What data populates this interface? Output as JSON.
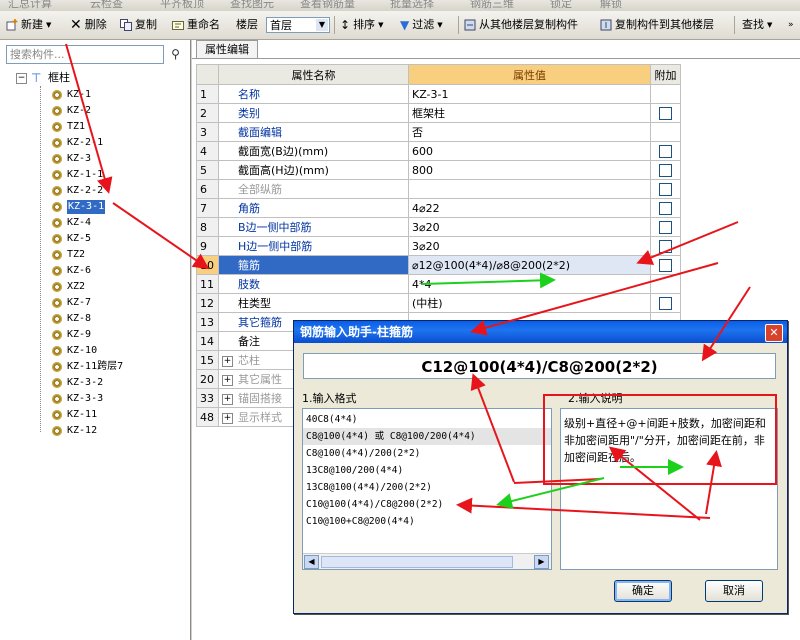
{
  "top_strip": [
    "汇总计算",
    "云检查",
    "平齐板顶",
    "查找图元",
    "查看钢筋量",
    "批量选择",
    "钢筋三维",
    "锁定",
    "解锁"
  ],
  "toolbar": {
    "new_label": "新建",
    "delete_label": "删除",
    "copy_label": "复制",
    "rename_label": "重命名",
    "floor_label": "楼层",
    "floor_value": "首层",
    "sort_label": "排序",
    "filter_label": "过滤",
    "copy_from_floor_label": "从其他楼层复制构件",
    "copy_to_floor_label": "复制构件到其他楼层",
    "find_label": "查找"
  },
  "sidebar": {
    "search_placeholder": "搜索构件...",
    "root_label": "框柱",
    "items": [
      "KZ-1",
      "KZ-2",
      "TZ1",
      "KZ-2-1",
      "KZ-3",
      "KZ-1-1",
      "KZ-2-2",
      "KZ-3-1",
      "KZ-4",
      "KZ-5",
      "TZ2",
      "KZ-6",
      "XZ2",
      "KZ-7",
      "KZ-8",
      "KZ-9",
      "KZ-10",
      "KZ-11跨层7",
      "KZ-3-2",
      "KZ-3-3",
      "KZ-11",
      "KZ-12"
    ],
    "selected_index": 7
  },
  "props": {
    "tab_label": "属性编辑",
    "header": {
      "name": "属性名称",
      "value": "属性值",
      "extra": "附加"
    },
    "rows": [
      {
        "num": "1",
        "name": "名称",
        "value": "KZ-3-1",
        "style": "blue",
        "check": false
      },
      {
        "num": "2",
        "name": "类别",
        "value": "框架柱",
        "style": "blue",
        "check": true
      },
      {
        "num": "3",
        "name": "截面编辑",
        "value": "否",
        "style": "blue",
        "check": false
      },
      {
        "num": "4",
        "name": "截面宽(B边)(mm)",
        "value": "600",
        "style": "plain",
        "check": true
      },
      {
        "num": "5",
        "name": "截面高(H边)(mm)",
        "value": "800",
        "style": "plain",
        "check": true
      },
      {
        "num": "6",
        "name": "全部纵筋",
        "value": "",
        "style": "gray",
        "check": true
      },
      {
        "num": "7",
        "name": "角筋",
        "value": "4⌀22",
        "style": "blue",
        "check": true
      },
      {
        "num": "8",
        "name": "B边一侧中部筋",
        "value": "3⌀20",
        "style": "blue",
        "check": true
      },
      {
        "num": "9",
        "name": "H边一侧中部筋",
        "value": "3⌀20",
        "style": "blue",
        "check": true
      },
      {
        "num": "10",
        "name": "箍筋",
        "value": "⌀12@100(4*4)/⌀8@200(2*2)",
        "style": "blue",
        "check": true,
        "selected": true
      },
      {
        "num": "11",
        "name": "肢数",
        "value": "4*4",
        "style": "blue",
        "check": false
      },
      {
        "num": "12",
        "name": "柱类型",
        "value": "(中柱)",
        "style": "plain",
        "check": true
      },
      {
        "num": "13",
        "name": "其它箍筋",
        "value": "",
        "style": "blue",
        "check": false
      },
      {
        "num": "14",
        "name": "备注",
        "value": "",
        "style": "plain",
        "check": false
      },
      {
        "num": "15",
        "name": "芯柱",
        "value": "",
        "style": "gray",
        "check": false,
        "group": true
      },
      {
        "num": "20",
        "name": "其它属性",
        "value": "",
        "style": "gray",
        "check": false,
        "group": true
      },
      {
        "num": "33",
        "name": "锚固搭接",
        "value": "",
        "style": "gray",
        "check": false,
        "group": true
      },
      {
        "num": "48",
        "name": "显示样式",
        "value": "",
        "style": "gray",
        "check": false,
        "group": true
      }
    ]
  },
  "dialog": {
    "title": "钢筋输入助手-柱箍筋",
    "formula": "C12@100(4*4)/C8@200(2*2)",
    "format_label": "1.输入格式",
    "desc_label": "2.输入说明",
    "formats": [
      "40C8(4*4)",
      "C8@100(4*4) 或 C8@100/200(4*4)",
      "C8@100(4*4)/200(2*2)",
      "13C8@100/200(4*4)",
      "13C8@100(4*4)/200(2*2)",
      "C10@100(4*4)/C8@200(2*2)",
      "C10@100+C8@200(4*4)"
    ],
    "format_highlight": 1,
    "description": "级别+直径+@+间距+肢数，加密间距和非加密间距用\"/\"分开，加密间距在前，非加密间距在后。",
    "ok_label": "确定",
    "cancel_label": "取消"
  },
  "colors": {
    "annotation_red": "#e8141b",
    "annotation_green": "#1cd11c",
    "selection": "#316ac5",
    "value_header": "#f8cf7e"
  }
}
